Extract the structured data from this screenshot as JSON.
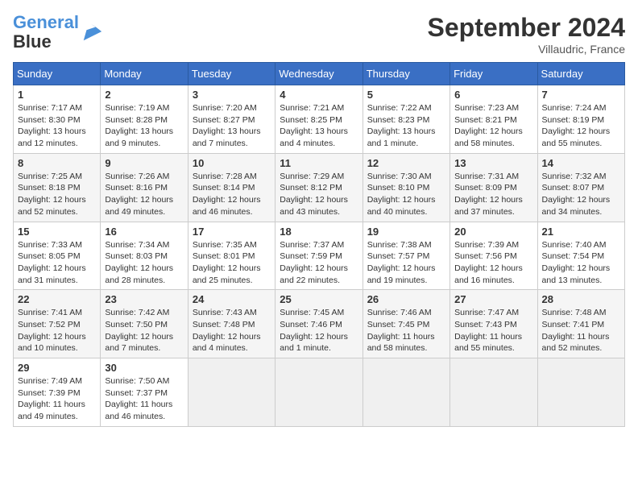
{
  "header": {
    "logo_line1": "General",
    "logo_line2": "Blue",
    "month_title": "September 2024",
    "subtitle": "Villaudric, France"
  },
  "days_of_week": [
    "Sunday",
    "Monday",
    "Tuesday",
    "Wednesday",
    "Thursday",
    "Friday",
    "Saturday"
  ],
  "weeks": [
    [
      {
        "day": "1",
        "sunrise": "7:17 AM",
        "sunset": "8:30 PM",
        "daylight": "13 hours and 12 minutes."
      },
      {
        "day": "2",
        "sunrise": "7:19 AM",
        "sunset": "8:28 PM",
        "daylight": "13 hours and 9 minutes."
      },
      {
        "day": "3",
        "sunrise": "7:20 AM",
        "sunset": "8:27 PM",
        "daylight": "13 hours and 7 minutes."
      },
      {
        "day": "4",
        "sunrise": "7:21 AM",
        "sunset": "8:25 PM",
        "daylight": "13 hours and 4 minutes."
      },
      {
        "day": "5",
        "sunrise": "7:22 AM",
        "sunset": "8:23 PM",
        "daylight": "13 hours and 1 minute."
      },
      {
        "day": "6",
        "sunrise": "7:23 AM",
        "sunset": "8:21 PM",
        "daylight": "12 hours and 58 minutes."
      },
      {
        "day": "7",
        "sunrise": "7:24 AM",
        "sunset": "8:19 PM",
        "daylight": "12 hours and 55 minutes."
      }
    ],
    [
      {
        "day": "8",
        "sunrise": "7:25 AM",
        "sunset": "8:18 PM",
        "daylight": "12 hours and 52 minutes."
      },
      {
        "day": "9",
        "sunrise": "7:26 AM",
        "sunset": "8:16 PM",
        "daylight": "12 hours and 49 minutes."
      },
      {
        "day": "10",
        "sunrise": "7:28 AM",
        "sunset": "8:14 PM",
        "daylight": "12 hours and 46 minutes."
      },
      {
        "day": "11",
        "sunrise": "7:29 AM",
        "sunset": "8:12 PM",
        "daylight": "12 hours and 43 minutes."
      },
      {
        "day": "12",
        "sunrise": "7:30 AM",
        "sunset": "8:10 PM",
        "daylight": "12 hours and 40 minutes."
      },
      {
        "day": "13",
        "sunrise": "7:31 AM",
        "sunset": "8:09 PM",
        "daylight": "12 hours and 37 minutes."
      },
      {
        "day": "14",
        "sunrise": "7:32 AM",
        "sunset": "8:07 PM",
        "daylight": "12 hours and 34 minutes."
      }
    ],
    [
      {
        "day": "15",
        "sunrise": "7:33 AM",
        "sunset": "8:05 PM",
        "daylight": "12 hours and 31 minutes."
      },
      {
        "day": "16",
        "sunrise": "7:34 AM",
        "sunset": "8:03 PM",
        "daylight": "12 hours and 28 minutes."
      },
      {
        "day": "17",
        "sunrise": "7:35 AM",
        "sunset": "8:01 PM",
        "daylight": "12 hours and 25 minutes."
      },
      {
        "day": "18",
        "sunrise": "7:37 AM",
        "sunset": "7:59 PM",
        "daylight": "12 hours and 22 minutes."
      },
      {
        "day": "19",
        "sunrise": "7:38 AM",
        "sunset": "7:57 PM",
        "daylight": "12 hours and 19 minutes."
      },
      {
        "day": "20",
        "sunrise": "7:39 AM",
        "sunset": "7:56 PM",
        "daylight": "12 hours and 16 minutes."
      },
      {
        "day": "21",
        "sunrise": "7:40 AM",
        "sunset": "7:54 PM",
        "daylight": "12 hours and 13 minutes."
      }
    ],
    [
      {
        "day": "22",
        "sunrise": "7:41 AM",
        "sunset": "7:52 PM",
        "daylight": "12 hours and 10 minutes."
      },
      {
        "day": "23",
        "sunrise": "7:42 AM",
        "sunset": "7:50 PM",
        "daylight": "12 hours and 7 minutes."
      },
      {
        "day": "24",
        "sunrise": "7:43 AM",
        "sunset": "7:48 PM",
        "daylight": "12 hours and 4 minutes."
      },
      {
        "day": "25",
        "sunrise": "7:45 AM",
        "sunset": "7:46 PM",
        "daylight": "12 hours and 1 minute."
      },
      {
        "day": "26",
        "sunrise": "7:46 AM",
        "sunset": "7:45 PM",
        "daylight": "11 hours and 58 minutes."
      },
      {
        "day": "27",
        "sunrise": "7:47 AM",
        "sunset": "7:43 PM",
        "daylight": "11 hours and 55 minutes."
      },
      {
        "day": "28",
        "sunrise": "7:48 AM",
        "sunset": "7:41 PM",
        "daylight": "11 hours and 52 minutes."
      }
    ],
    [
      {
        "day": "29",
        "sunrise": "7:49 AM",
        "sunset": "7:39 PM",
        "daylight": "11 hours and 49 minutes."
      },
      {
        "day": "30",
        "sunrise": "7:50 AM",
        "sunset": "7:37 PM",
        "daylight": "11 hours and 46 minutes."
      },
      null,
      null,
      null,
      null,
      null
    ]
  ]
}
